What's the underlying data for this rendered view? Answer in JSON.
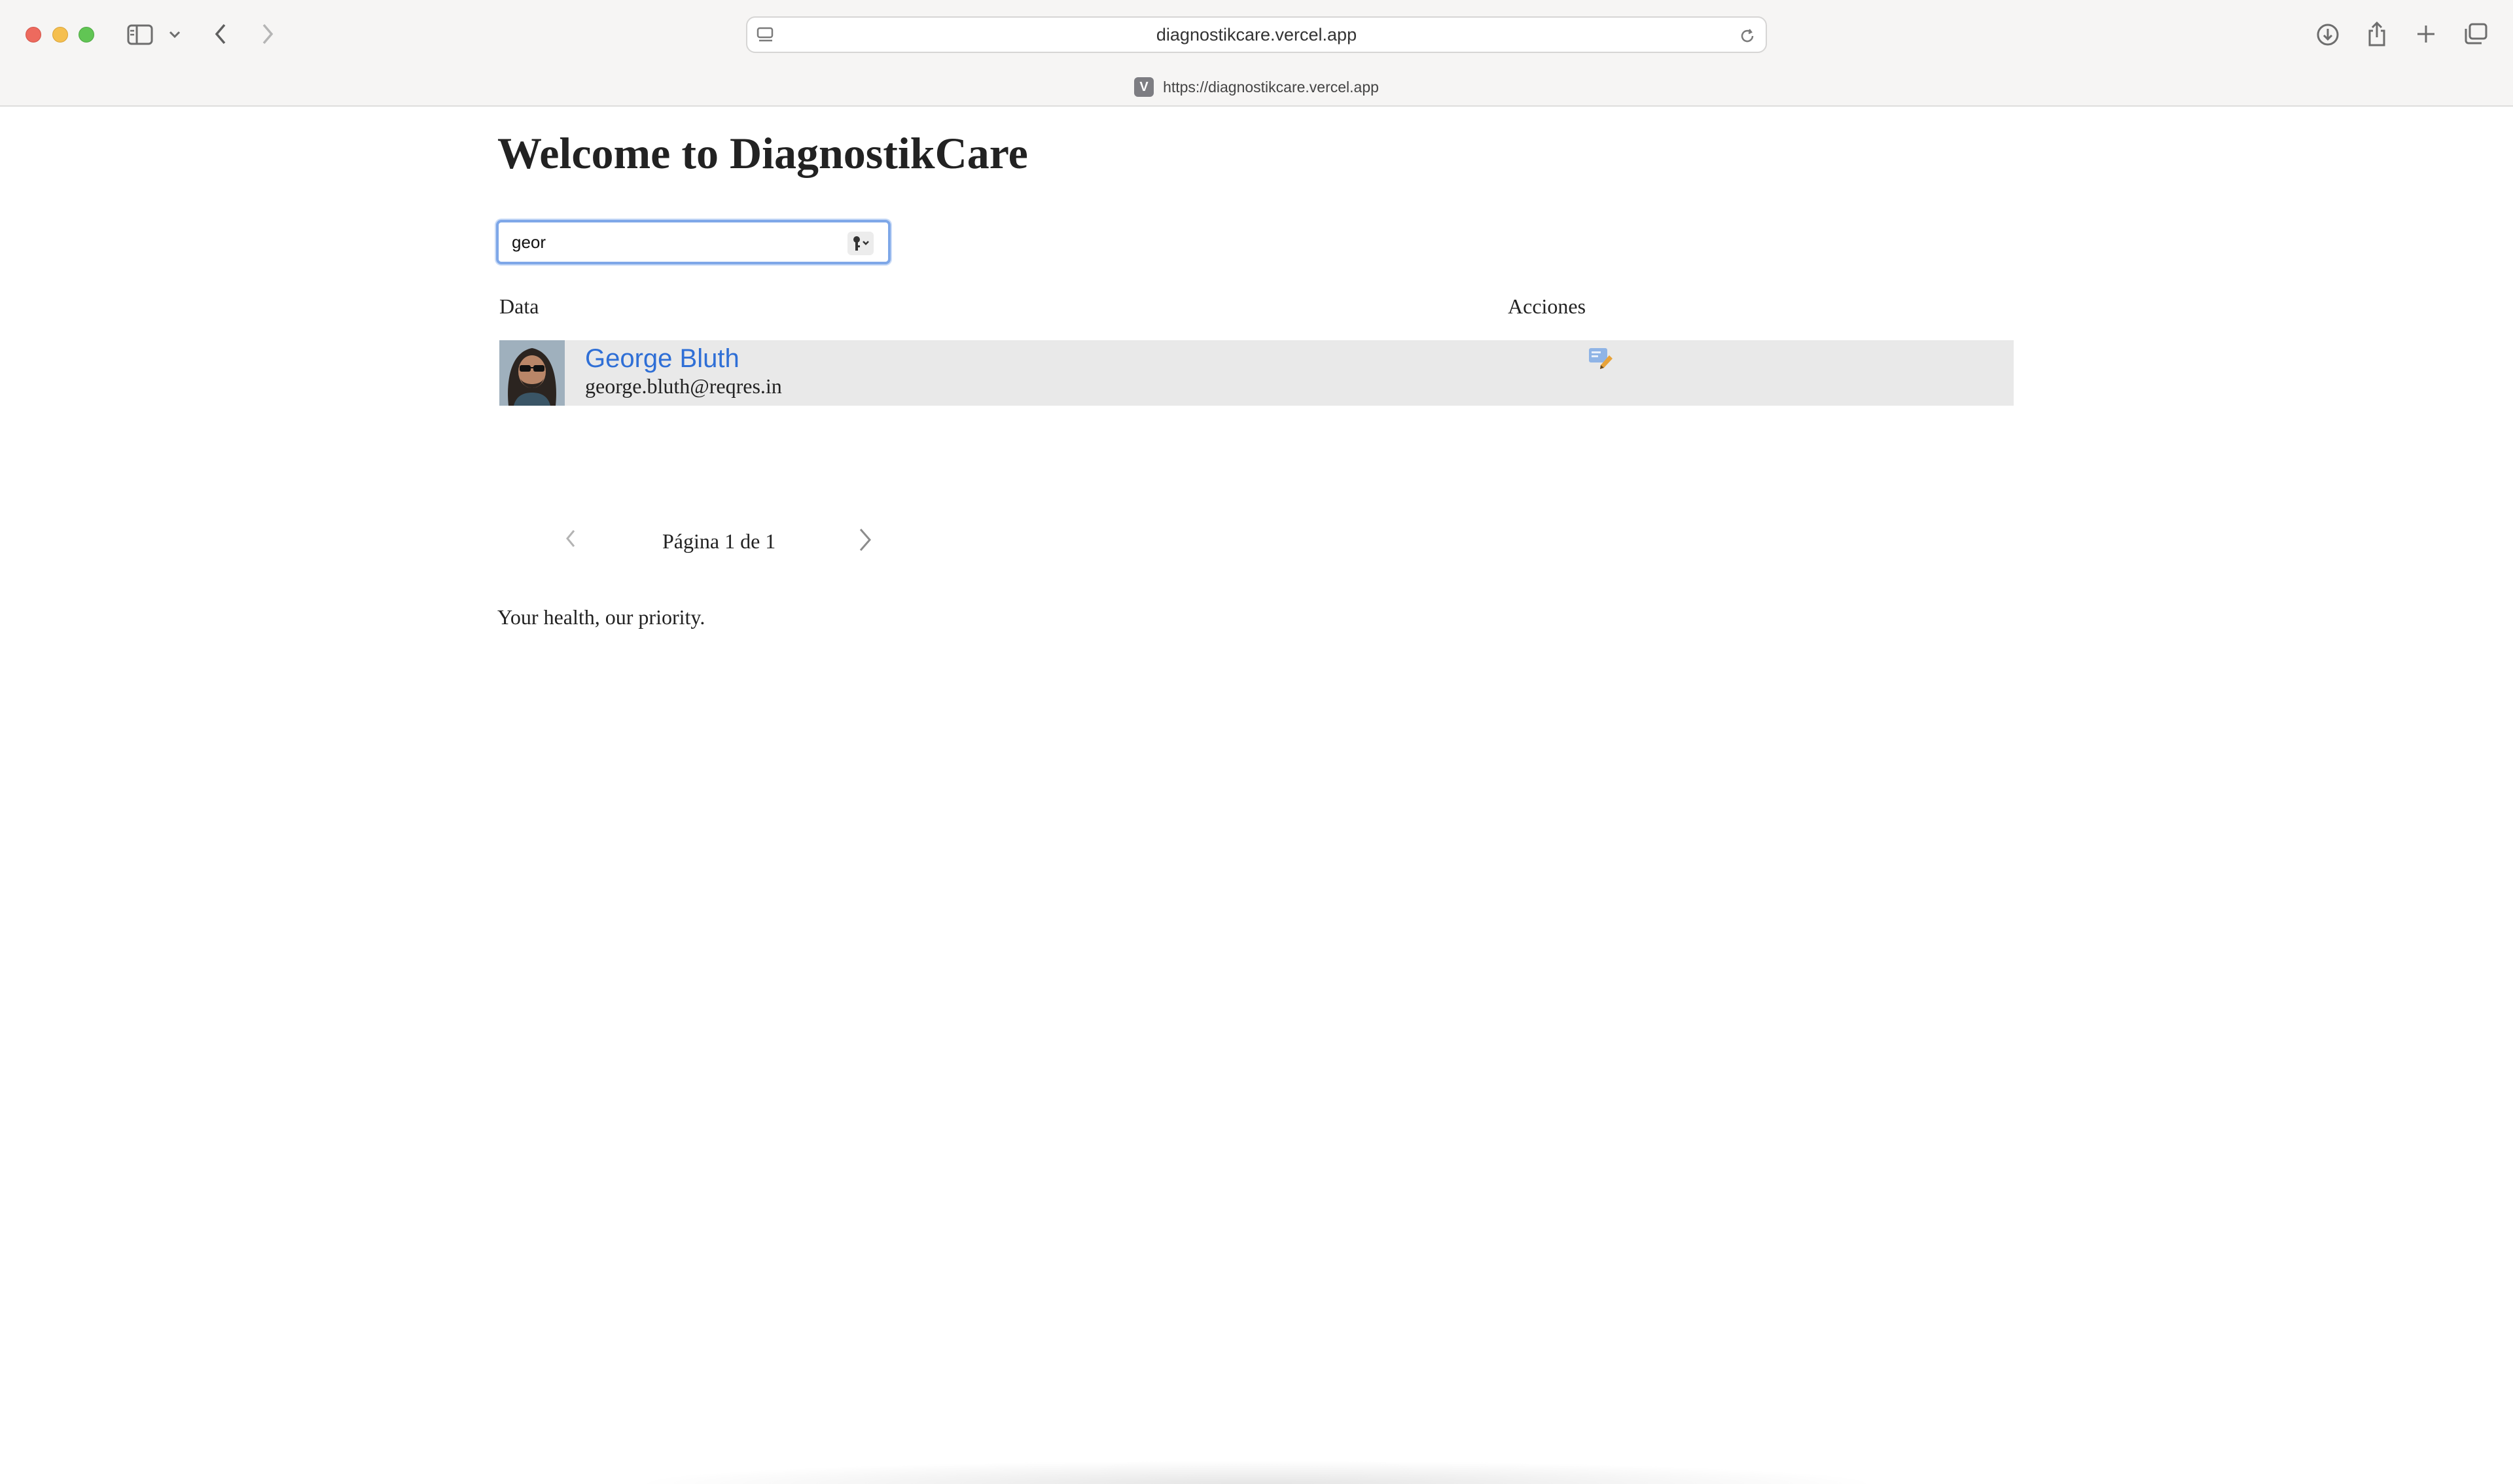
{
  "browser": {
    "address": "diagnostikcare.vercel.app",
    "tab_url": "https://diagnostikcare.vercel.app",
    "favicon_letter": "V",
    "icons": [
      "sidebar-icon",
      "chevron-down-icon",
      "back-arrow-icon",
      "forward-arrow-icon",
      "page-menu-icon",
      "reload-icon",
      "download-icon",
      "share-icon",
      "new-tab-icon",
      "tab-overview-icon"
    ]
  },
  "page": {
    "title": "Welcome to DiagnostikCare",
    "search": {
      "value": "geor",
      "icon": "password-key-icon"
    },
    "table": {
      "headers": {
        "data": "Data",
        "actions": "Acciones"
      },
      "rows": [
        {
          "name": "George Bluth",
          "email": "george.bluth@reqres.in",
          "action_icon": "edit-icon"
        }
      ]
    },
    "pagination": {
      "label": "Página 1 de 1"
    },
    "tagline": "Your health, our priority."
  },
  "colors": {
    "link": "#2f6fd6",
    "row_background": "#e9e9e9",
    "focus_ring": "#7ea7e8"
  }
}
